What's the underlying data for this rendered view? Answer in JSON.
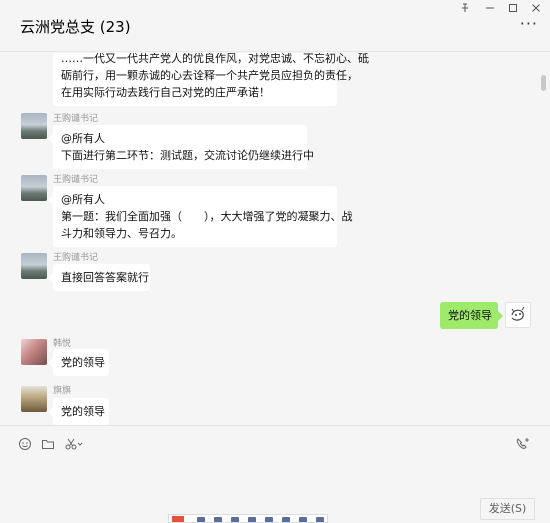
{
  "window": {
    "title": "云洲党总支 (23)",
    "controls": {
      "pin_icon": "pin-icon",
      "minimize_icon": "minimize-icon",
      "maximize_icon": "maximize-icon",
      "close_icon": "close-icon"
    },
    "more_icon": "more-dots-icon"
  },
  "messages": [
    {
      "sender": "",
      "avatar": "",
      "side": "left",
      "lines": [
        "……一代又一代共产党人的优良作风，对党忠诚、不忘初心、砥",
        "砺前行，用一颗赤诚的心去诠释一个共产党员应担负的责任，",
        "在用实际行动去践行自己对党的庄严承诺！"
      ]
    },
    {
      "sender": "王购谴书记",
      "avatar": "landscape-avatar",
      "side": "left",
      "lines": [
        "@所有人",
        "下面进行第二环节：测试题，交流讨论仍继续进行中"
      ]
    },
    {
      "sender": "王购谴书记",
      "avatar": "landscape-avatar",
      "side": "left",
      "lines": [
        "@所有人",
        "第一题：我们全面加强（",
        "），大大增强了党的凝聚力、战",
        "斗力和领导力、号召力。"
      ]
    },
    {
      "sender": "王购谴书记",
      "avatar": "landscape-avatar",
      "side": "left",
      "lines": [
        "直接回答答案就行"
      ]
    },
    {
      "sender": "",
      "avatar": "cartoon-avatar",
      "side": "right",
      "lines": [
        "党的领导"
      ]
    },
    {
      "sender": "韩悦",
      "avatar": "portrait-avatar",
      "side": "left",
      "lines": [
        "党的领导"
      ]
    },
    {
      "sender": "旗旗",
      "avatar": "portrait-avatar",
      "side": "left",
      "lines": [
        "党的领导"
      ]
    }
  ],
  "toolbar": {
    "emoji_icon": "emoji-icon",
    "folder_icon": "folder-icon",
    "scissors_icon": "scissors-icon",
    "call_icon": "phone-call-icon"
  },
  "send_button": "发送(S)",
  "colors": {
    "background": "#f5f5f5",
    "bubble_incoming": "#ffffff",
    "bubble_outgoing": "#9eea6a",
    "sender_name": "#999999"
  }
}
